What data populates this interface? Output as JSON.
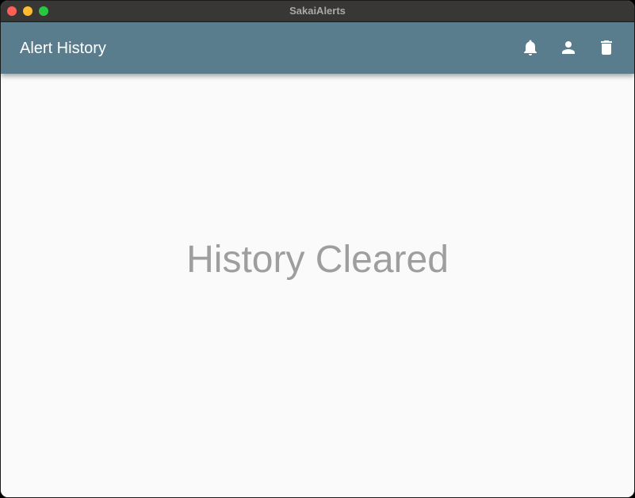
{
  "window": {
    "title": "SakaiAlerts"
  },
  "appbar": {
    "title": "Alert History",
    "actions": [
      {
        "name": "notifications",
        "icon": "bell-icon"
      },
      {
        "name": "account",
        "icon": "person-icon"
      },
      {
        "name": "clear-history",
        "icon": "trash-icon"
      }
    ]
  },
  "main": {
    "message": "History Cleared"
  },
  "colors": {
    "titlebar": "#383736",
    "appbar": "#5a7d8d",
    "background": "#fafafa",
    "message_text": "#9e9e9e",
    "close": "#fe5f57",
    "minimize": "#febc2e",
    "maximize": "#28c840"
  }
}
